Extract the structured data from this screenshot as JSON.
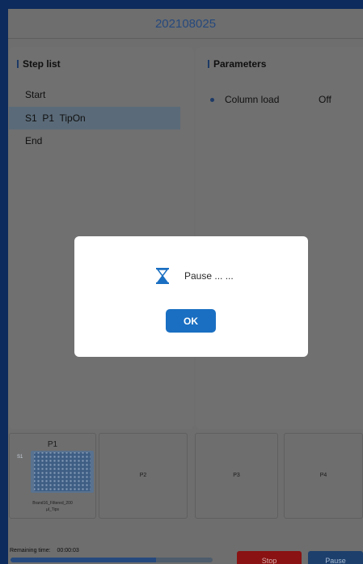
{
  "header": {
    "title": "202108025"
  },
  "step_list": {
    "title": "Step list",
    "steps": [
      {
        "label": "Start"
      },
      {
        "label": "S1  P1  TipOn",
        "selected": true
      },
      {
        "label": "End"
      }
    ]
  },
  "parameters": {
    "title": "Parameters",
    "items": [
      {
        "name": "Column load",
        "value": "Off"
      }
    ]
  },
  "plates": {
    "p1": {
      "label": "P1",
      "slot": "S1",
      "caption_line1": "Brand16_Filtered_200",
      "caption_line2": "µl_Tips"
    },
    "p2": {
      "label": "P2"
    },
    "p3": {
      "label": "P3"
    },
    "p4": {
      "label": "P4"
    }
  },
  "footer": {
    "remaining_label": "Remaining time:",
    "remaining_value": "00:00:03",
    "progress_fraction": 0.72,
    "stop_label": "Stop",
    "pause_label": "Pause"
  },
  "dialog": {
    "message": "Pause ... ...",
    "ok_label": "OK",
    "icon": "hourglass-icon"
  },
  "colors": {
    "accent": "#1a6fc2",
    "stop": "#8a1212",
    "pause": "#1d3f6c"
  }
}
